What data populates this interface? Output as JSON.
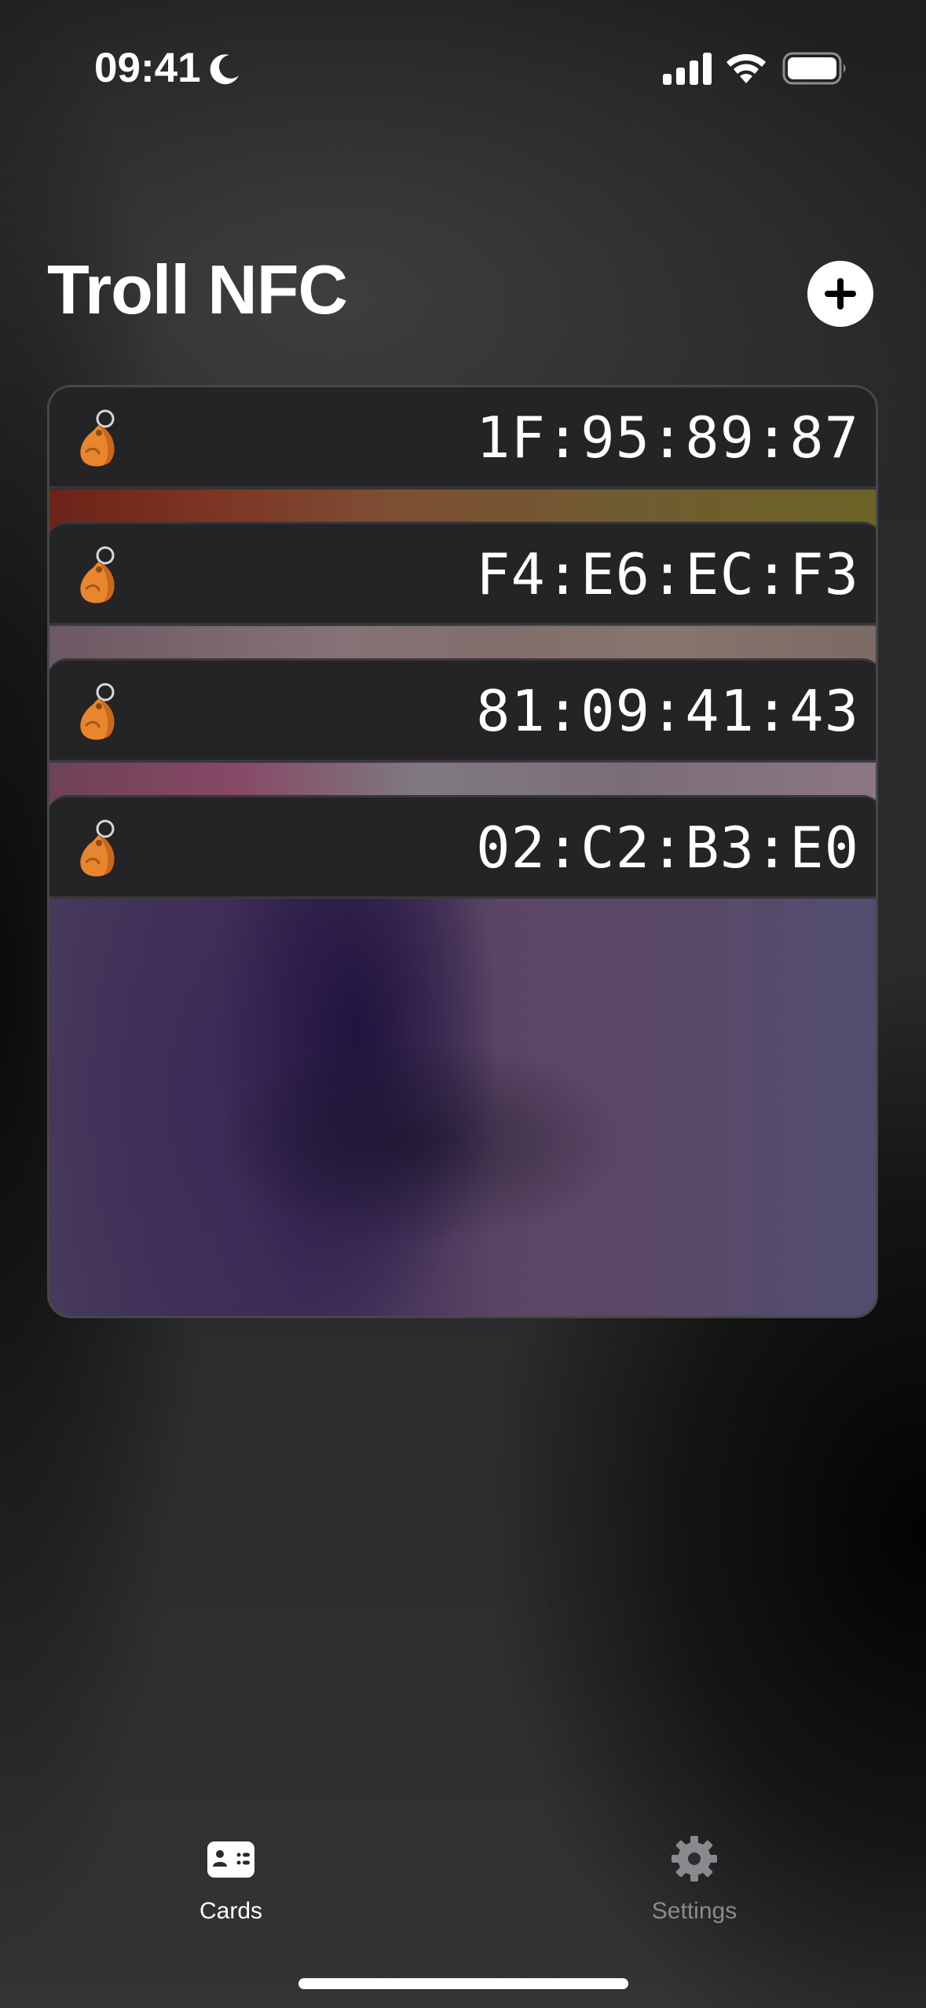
{
  "status_bar": {
    "time": "09:41",
    "icons": [
      "moon-icon",
      "cellular-signal-icon",
      "wifi-icon",
      "battery-icon"
    ]
  },
  "header": {
    "title": "Troll NFC",
    "add_button_icon": "plus-circle-icon"
  },
  "cards": [
    {
      "uid": "1F:95:89:87",
      "icon": "key-fob-icon",
      "stripe_colors": [
        "#6c2318",
        "#7e4d33",
        "#6b6326"
      ]
    },
    {
      "uid": "F4:E6:EC:F3",
      "icon": "key-fob-icon",
      "stripe_colors": [
        "#6d5863",
        "#857276",
        "#7b6a64"
      ]
    },
    {
      "uid": "81:09:41:43",
      "icon": "key-fob-icon",
      "stripe_colors": [
        "#6e4256",
        "#7f7a80",
        "#8b7782"
      ]
    },
    {
      "uid": "02:C2:B3:E0",
      "icon": "key-fob-icon",
      "stripe_colors": [
        "#4a3f5c",
        "#3b2c55",
        "#524d6f"
      ]
    }
  ],
  "tab_bar": {
    "tabs": [
      {
        "label": "Cards",
        "icon": "person-card-icon",
        "selected": true
      },
      {
        "label": "Settings",
        "icon": "gear-icon",
        "selected": false
      }
    ]
  },
  "colors": {
    "key_fob": "#e8862f",
    "tab_selected": "#ffffff",
    "tab_unselected": "#8a8a8e",
    "card_bar": "#242426"
  }
}
